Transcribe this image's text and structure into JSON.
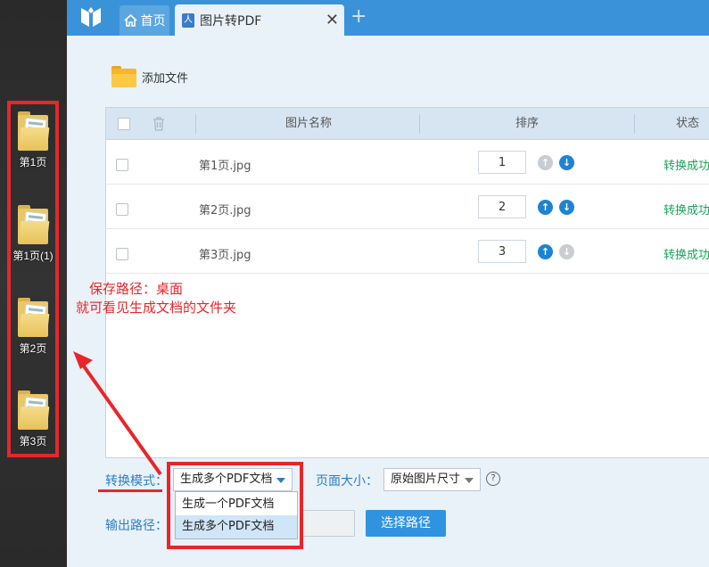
{
  "desktop": {
    "icons": [
      {
        "label": "第1页"
      },
      {
        "label": "第1页(1)"
      },
      {
        "label": "第2页"
      },
      {
        "label": "第3页"
      }
    ]
  },
  "tabs": {
    "home_label": "首页",
    "active_label": "图片转PDF",
    "close_glyph": "✕",
    "add_glyph": "+"
  },
  "toolbar": {
    "add_file_label": "添加文件"
  },
  "table": {
    "columns": {
      "name": "图片名称",
      "order": "排序",
      "status": "状态"
    },
    "rows": [
      {
        "name": "第1页.jpg",
        "order": "1",
        "status": "转换成功",
        "up_enabled": false,
        "down_enabled": true
      },
      {
        "name": "第2页.jpg",
        "order": "2",
        "status": "转换成功",
        "up_enabled": true,
        "down_enabled": true
      },
      {
        "name": "第3页.jpg",
        "order": "3",
        "status": "转换成功",
        "up_enabled": true,
        "down_enabled": false
      }
    ]
  },
  "annotation": {
    "line1": "保存路径：桌面",
    "line2": "就可看见生成文档的文件夹"
  },
  "options": {
    "mode_label": "转换模式：",
    "mode_value": "生成多个PDF文档",
    "mode_options": [
      "生成一个PDF文档",
      "生成多个PDF文档"
    ],
    "page_size_label": "页面大小：",
    "page_size_value": "原始图片尺寸",
    "help_glyph": "?",
    "output_label": "输出路径：",
    "choose_path_label": "选择路径"
  },
  "colors": {
    "accent": "#3a93d8",
    "success": "#19a35b",
    "highlight_red": "#e8262a"
  }
}
